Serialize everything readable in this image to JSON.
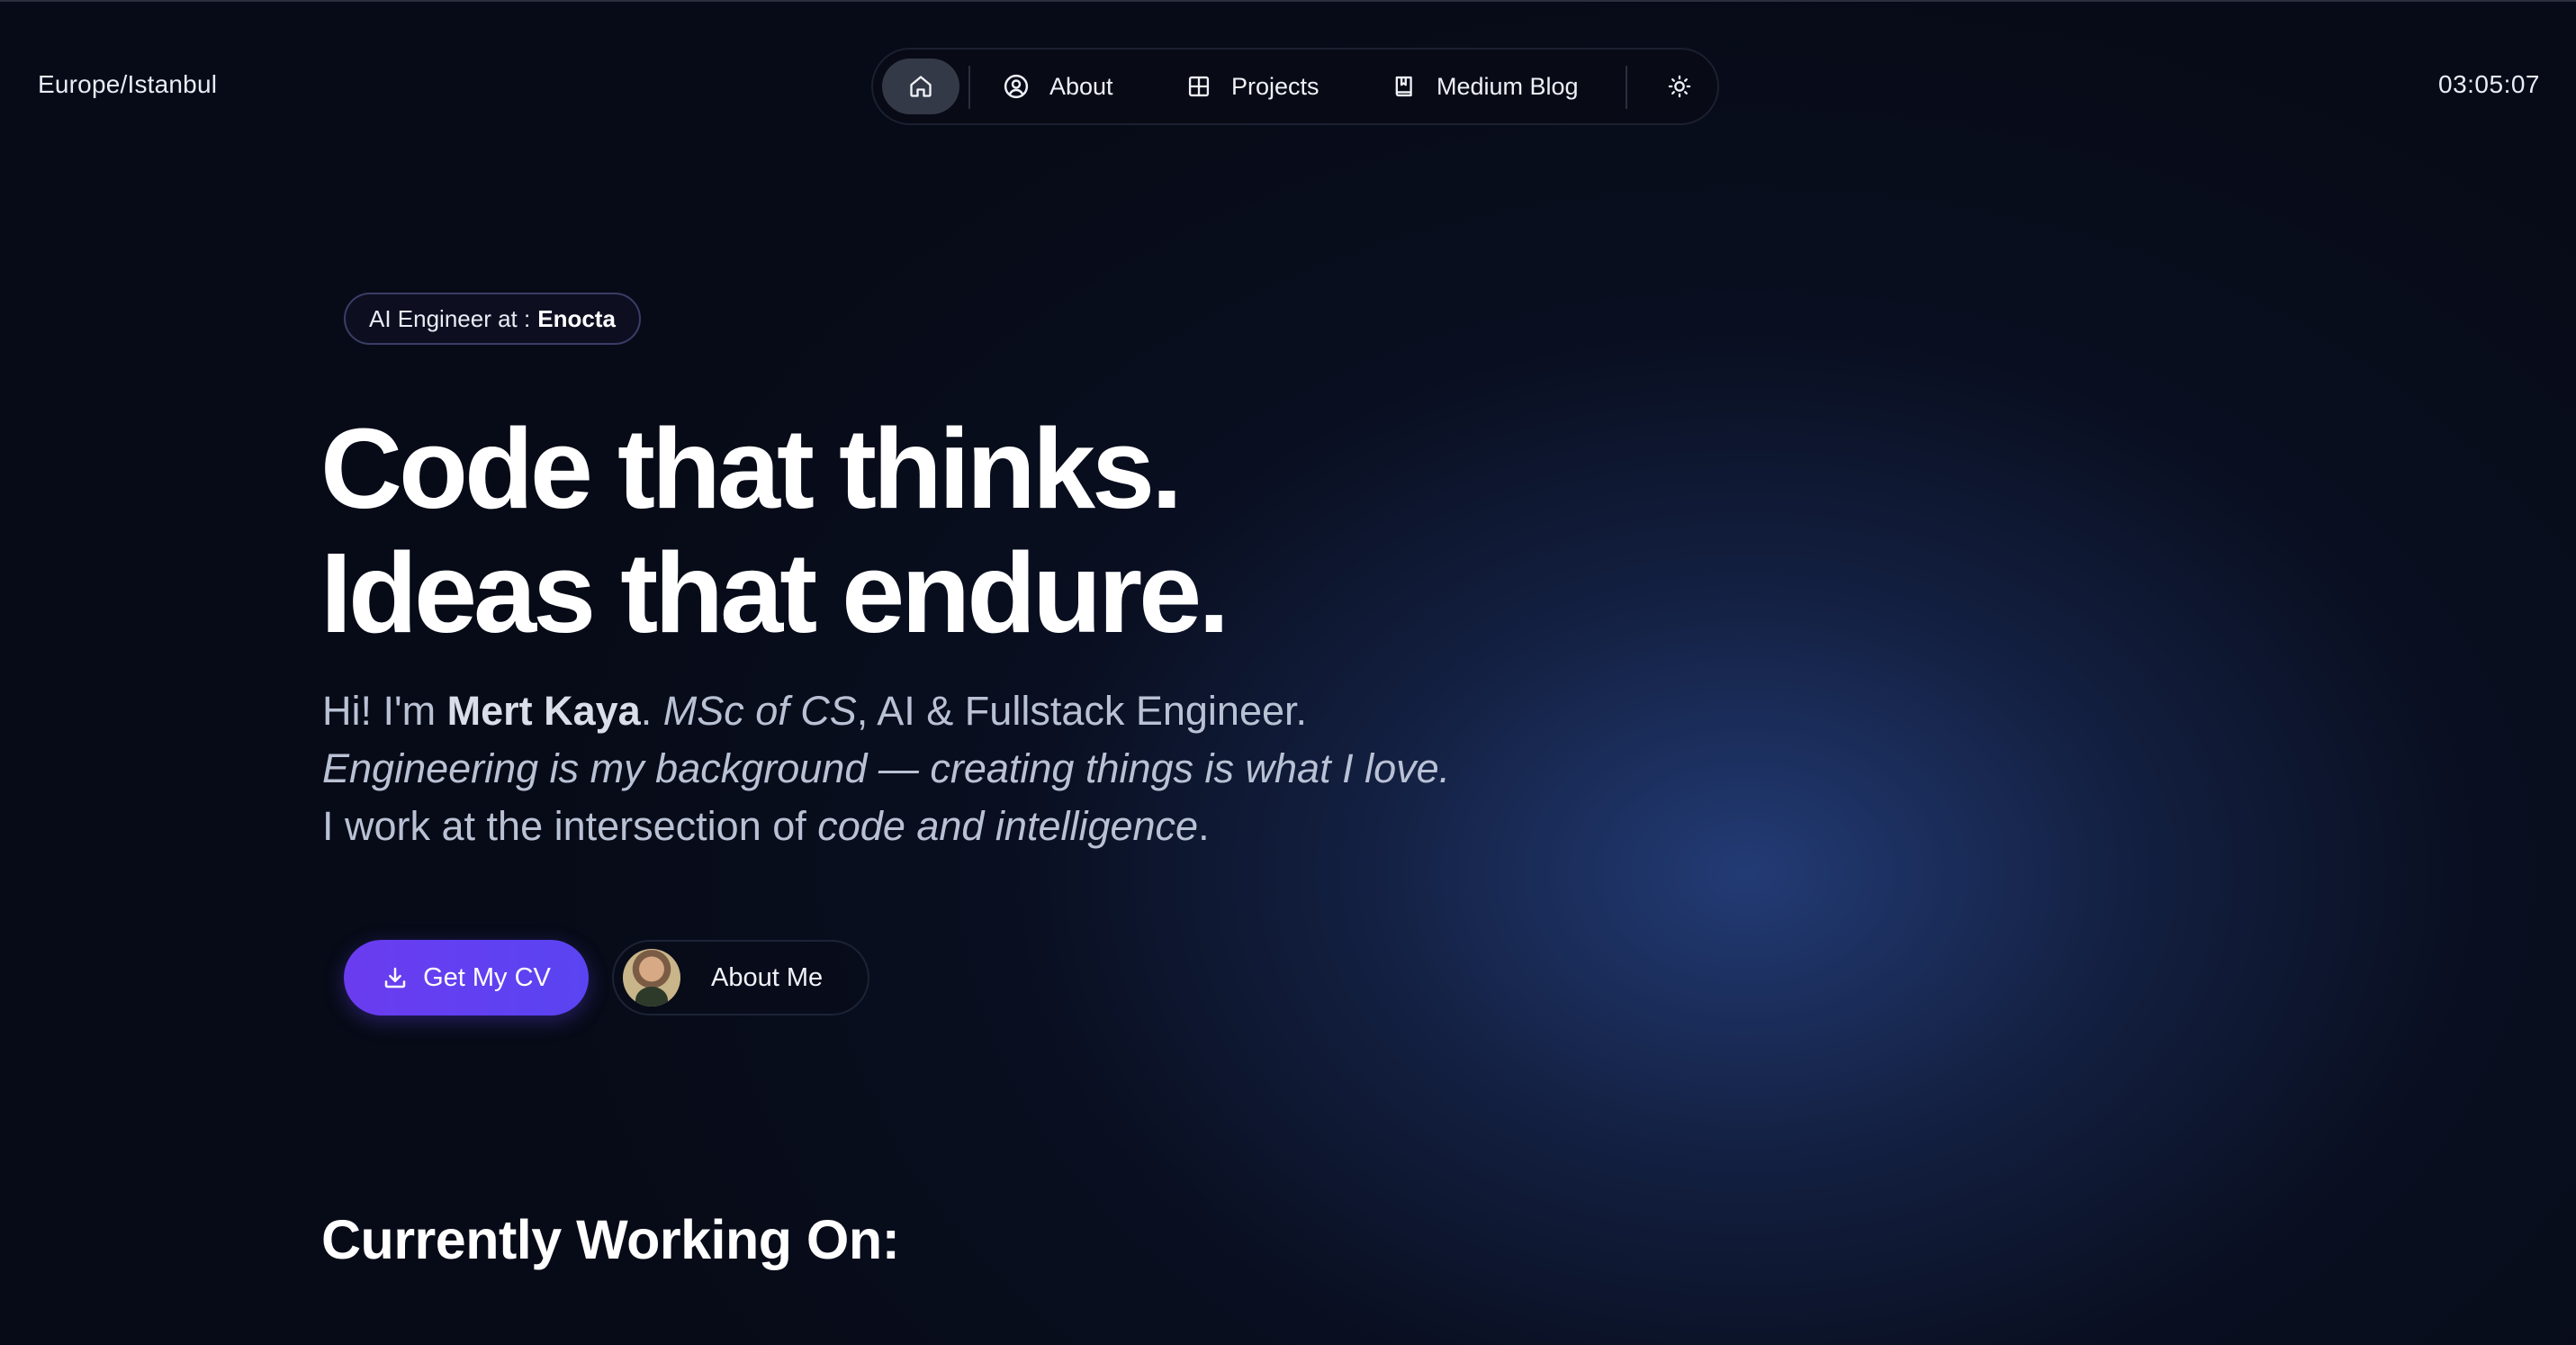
{
  "header": {
    "timezone": "Europe/Istanbul",
    "clock": "03:05:07"
  },
  "nav": {
    "home_icon": "home-icon",
    "items": [
      {
        "label": "About",
        "icon": "user-circle-icon"
      },
      {
        "label": "Projects",
        "icon": "grid-icon"
      },
      {
        "label": "Medium Blog",
        "icon": "book-icon"
      }
    ],
    "theme_icon": "sun-icon"
  },
  "hero": {
    "badge_prefix": "AI Engineer at :",
    "badge_company": "Enocta",
    "headline_line1": "Code that thinks.",
    "headline_line2": "Ideas that endure.",
    "intro": {
      "l1_a": "Hi! I'm ",
      "name": "Mert Kaya",
      "l1_b": ". ",
      "degree": "MSc of CS",
      "l1_c": ", AI & Fullstack Engineer.",
      "line2": "Engineering is my background — creating things is what I love.",
      "l3_a": "I work at the intersection of ",
      "l3_em": "code and intelligence",
      "l3_b": "."
    },
    "cv_button": "Get My CV",
    "about_button": "About Me"
  },
  "section": {
    "title": "Currently Working On:"
  },
  "colors": {
    "accent": "#6a3cf0",
    "background": "#070b17",
    "glow": "#243e7a"
  }
}
